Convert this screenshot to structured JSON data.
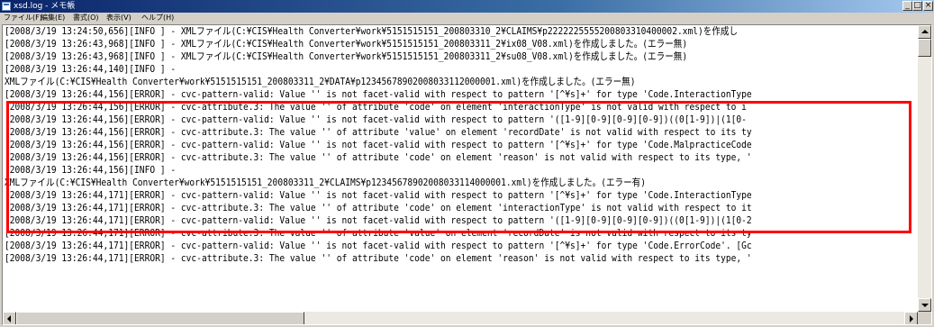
{
  "window": {
    "title": "xsd.log - メモ帳",
    "minimize": "_",
    "maximize": "□",
    "close": "×"
  },
  "menu": [
    "ファイル(F)",
    "編集(E)",
    "書式(O)",
    "表示(V)",
    "ヘルプ(H)"
  ],
  "lines": [
    "[2008/3/19 13:24:50,656][INFO ] - XMLファイル(C:¥CIS¥Health Converter¥work¥5151515151_200803310_2¥CLAIMS¥p2222225555200803310400002.xml)を作成し",
    "[2008/3/19 13:26:43,968][INFO ] - XMLファイル(C:¥CIS¥Health Converter¥work¥5151515151_200803311_2¥ix08_V08.xml)を作成しました。(エラー無)",
    "[2008/3/19 13:26:43,968][INFO ] - XMLファイル(C:¥CIS¥Health Converter¥work¥5151515151_200803311_2¥su08_V08.xml)を作成しました。(エラー無)",
    "[2008/3/19 13:26:44,140][INFO ] -",
    "XMLファイル(C:¥CIS¥Health Converter¥work¥5151515151_200803311_2¥DATA¥p12345678902008033112000001.xml)を作成しました。(エラー無)",
    "[2008/3/19 13:26:44,156][ERROR] - cvc-pattern-valid: Value '' is not facet-valid with respect to pattern '[^¥s]+' for type 'Code.InteractionType",
    "[2008/3/19 13:26:44,156][ERROR] - cvc-attribute.3: The value '' of attribute 'code' on element 'interactionType' is not valid with respect to i",
    "[2008/3/19 13:26:44,156][ERROR] - cvc-pattern-valid: Value '' is not facet-valid with respect to pattern '([1-9][0-9][0-9][0-9])((0[1-9])|(1[0-",
    "[2008/3/19 13:26:44,156][ERROR] - cvc-attribute.3: The value '' of attribute 'value' on element 'recordDate' is not valid with respect to its ty",
    "[2008/3/19 13:26:44,156][ERROR] - cvc-pattern-valid: Value '' is not facet-valid with respect to pattern '[^¥s]+' for type 'Code.MalpracticeCode",
    "[2008/3/19 13:26:44,156][ERROR] - cvc-attribute.3: The value '' of attribute 'code' on element 'reason' is not valid with respect to its type, '",
    "[2008/3/19 13:26:44,156][INFO ] -",
    "XMLファイル(C:¥CIS¥Health Converter¥work¥5151515151_200803311_2¥CLAIMS¥p12345678902008033114000001.xml)を作成しました。(エラー有)",
    "[2008/3/19 13:26:44,171][ERROR] - cvc-pattern-valid: Value '' is not facet-valid with respect to pattern '[^¥s]+' for type 'Code.InteractionType",
    "[2008/3/19 13:26:44,171][ERROR] - cvc-attribute.3: The value '' of attribute 'code' on element 'interactionType' is not valid with respect to it",
    "[2008/3/19 13:26:44,171][ERROR] - cvc-pattern-valid: Value '' is not facet-valid with respect to pattern '([1-9][0-9][0-9][0-9])((0[1-9])|(1[0-2",
    "[2008/3/19 13:26:44,171][ERROR] - cvc-attribute.3: The value '' of attribute 'value' on element 'recordDate' is not valid with respect to its ty",
    "[2008/3/19 13:26:44,171][ERROR] - cvc-pattern-valid: Value '' is not facet-valid with respect to pattern '[^¥s]+' for type 'Code.ErrorCode'. [Gc",
    "[2008/3/19 13:26:44,171][ERROR] - cvc-attribute.3: The value '' of attribute 'code' on element 'reason' is not valid with respect to its type, '"
  ],
  "colors": {
    "highlight_border": "#ff0000",
    "titlebar_start": "#0a246a",
    "titlebar_end": "#a6caf0",
    "window_face": "#d4d0c8"
  }
}
